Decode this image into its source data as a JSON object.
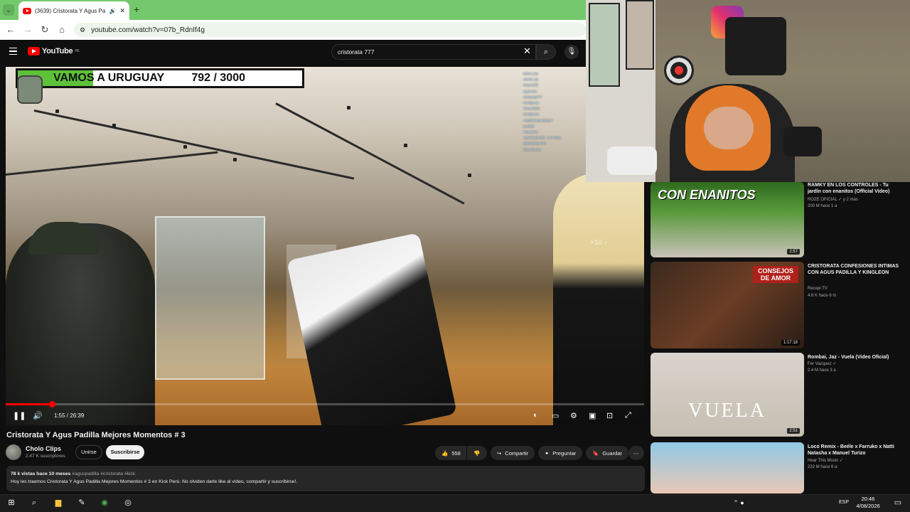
{
  "browser": {
    "tab_title": "(3639) Cristorata Y Agus Pa",
    "url": "youtube.com/watch?v=07b_RdnIf4g",
    "new_tab_label": "+"
  },
  "youtube": {
    "logo_text": "YouTube",
    "logo_region": "PE",
    "search_value": "cristorata 777"
  },
  "overlay": {
    "goal_text": "VAMOS A URUGUAY",
    "goal_count": "792 / 3000",
    "goal_progress": 0.264,
    "skip_label": "+10",
    "chat_names": [
      "kolont_lop",
      "Jeison_dp",
      "maureo98",
      "taylor123",
      "cristorata777",
      "ConQueso",
      "Alvaro5505",
      "ConQueso",
      "ANDERSONKENDY",
      "jro1990",
      "Alexandro",
      "AlexShadow29 : su lompa",
      "aldervilches273",
      "kimesfrancs"
    ]
  },
  "player": {
    "time_current": "1:55",
    "time_total": "26:39",
    "progress": 0.072
  },
  "video": {
    "title": "Cristorata Y Agus Padilla Mejores Momentos # 3",
    "channel": "Cholo Clips",
    "subscribers": "2.47 K suscriptores",
    "join_label": "Unirse",
    "subscribe_label": "Suscribirse",
    "likes": "558",
    "share_label": "Compartir",
    "ask_label": "Preguntar",
    "save_label": "Guardar",
    "views_time": "78 k vistas  hace 10 meses",
    "tags": "#aguspadilla #cristorata #kick",
    "description": "Hoy les traemos Cristorata Y Agus Padilla Mejores Momentos # 3 en Kick Perú. No olviden darle like al video, compartir y suscribirse!."
  },
  "recommendations": [
    {
      "title": "RAMKY EN LOS CONTROLES - Tu jardín con enanitos (Official Video)",
      "channel": "ROZE OFICIAL",
      "channel_extra": "y 2 más",
      "meta": "200 M  hace 1 a",
      "duration": "2:57",
      "thumb_text": "CON ENANITOS"
    },
    {
      "title": "CRISTORATA CONFESIONES INTIMAS CON AGUS PADILLA Y KINGLEON",
      "channel": "Recopi TV",
      "channel_extra": "",
      "meta": "4.6 K  hace 6 m",
      "duration": "1:17:18",
      "thumb_text": "CONSEJOS DE AMOR"
    },
    {
      "title": "Rombai, Jaz - Vuela (Video Oficial)",
      "channel": "Fer Vazquez",
      "channel_extra": "",
      "meta": "2.4 M  hace 3 a",
      "duration": "2:51",
      "thumb_text": "VUELA"
    },
    {
      "title": "Loco Remix - Beéle x Farruko x Natti Natasha x Manuel Turizo",
      "channel": "Hear This Music",
      "channel_extra": "",
      "meta": "232 M  hace 6 a",
      "duration": "",
      "thumb_text": ""
    }
  ],
  "taskbar": {
    "language": "ESP",
    "time": "20:46",
    "date": "4/08/2026"
  },
  "colors": {
    "brand_red": "#ff0000",
    "tab_green": "#73c96b",
    "goal_green": "#5ec13a",
    "yt_bg": "#0f0f0f"
  }
}
